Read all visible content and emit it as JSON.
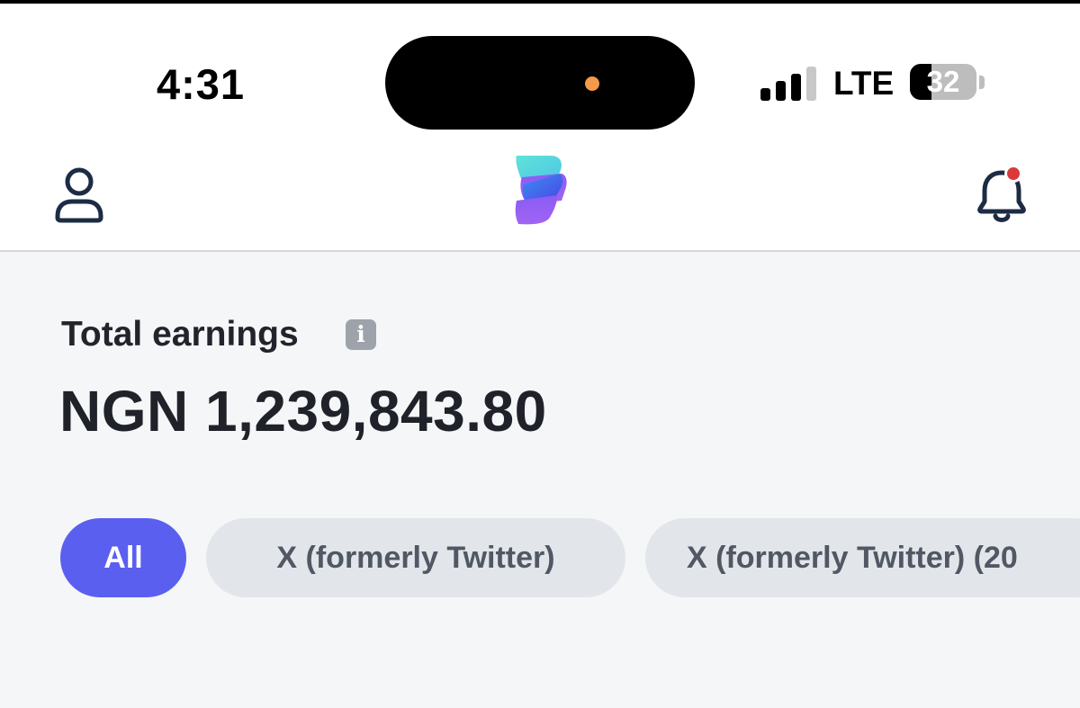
{
  "status_bar": {
    "time": "4:31",
    "network": "LTE",
    "battery_level": "32",
    "battery_fraction": 0.32,
    "signal_bars_active": 3,
    "signal_bars_total": 4
  },
  "header": {
    "profile_icon": "user-icon",
    "logo": "app-logo",
    "notification_icon": "bell-icon",
    "has_unread_notification": true
  },
  "earnings": {
    "label": "Total earnings",
    "info_icon": "info-icon",
    "info_glyph": "i",
    "amount": "NGN 1,239,843.80"
  },
  "filters": [
    {
      "label": "All",
      "selected": true
    },
    {
      "label": "X (formerly Twitter)",
      "selected": false
    },
    {
      "label": "X (formerly Twitter) (20",
      "selected": false
    }
  ],
  "colors": {
    "accent": "#5b5ff0",
    "notification_dot": "#d93a3a",
    "recording_dot": "#f2994a",
    "chip_inactive_bg": "#e2e5ea",
    "page_bg": "#f5f6f8"
  }
}
